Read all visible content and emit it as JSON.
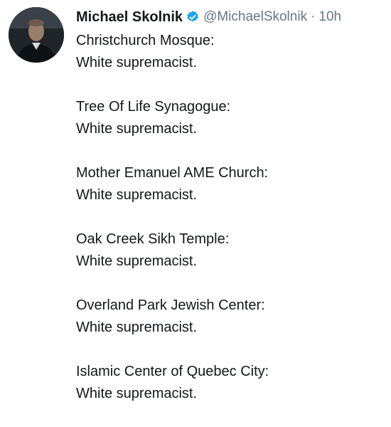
{
  "tweet": {
    "author": {
      "name": "Michael Skolnik",
      "handle": "@MichaelSkolnik",
      "verified": true
    },
    "separator": "·",
    "time": "10h",
    "stanzas": [
      {
        "place": "Christchurch Mosque:",
        "verdict": "White supremacist."
      },
      {
        "place": "Tree Of Life Synagogue:",
        "verdict": "White supremacist."
      },
      {
        "place": "Mother Emanuel AME Church:",
        "verdict": "White supremacist."
      },
      {
        "place": "Oak Creek Sikh Temple:",
        "verdict": "White supremacist."
      },
      {
        "place": "Overland Park Jewish Center:",
        "verdict": "White supremacist."
      },
      {
        "place": "Islamic Center of Quebec City:",
        "verdict": "White supremacist."
      }
    ]
  },
  "colors": {
    "text": "#14171a",
    "secondary": "#657786",
    "verified_badge": "#1da1f2",
    "background": "#ffffff"
  },
  "icons": {
    "verified": "verified-badge-icon",
    "avatar": "profile-photo"
  }
}
